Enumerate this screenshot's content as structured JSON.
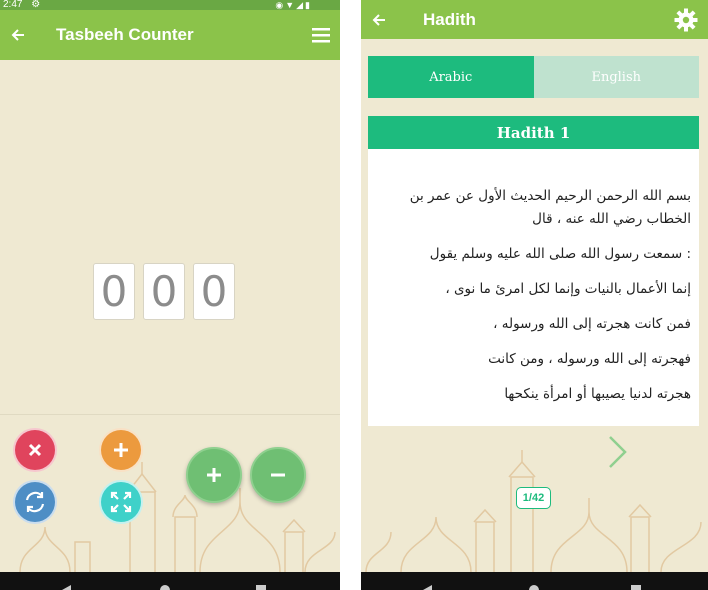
{
  "tasbeeh": {
    "status_time": "2:47",
    "title": "Tasbeeh Counter",
    "digits": [
      "0",
      "0",
      "0"
    ],
    "colors": {
      "reset": "#e0445d",
      "add": "#ec9a3e",
      "refresh": "#4e8ec5",
      "fullscreen": "#3fd1c9",
      "increment": "#6fbf73",
      "decrement": "#6fbf73"
    },
    "icons": [
      "back-arrow-icon",
      "menu-icon",
      "close-icon",
      "plus-icon",
      "refresh-icon",
      "expand-icon",
      "minus-icon"
    ]
  },
  "hadith": {
    "title": "Hadith",
    "tabs": [
      {
        "label": "Arabic",
        "active": true
      },
      {
        "label": "English",
        "active": false
      }
    ],
    "card_title": "Hadith 1",
    "lines": [
      "بسم الله الرحمن الرحيم الحديث الأول عن عمر بن الخطاب رضي الله عنه ، قال",
      ": سمعت رسول الله صلى الله عليه وسلم يقول",
      "إنما الأعمال بالنيات وإنما لكل امرئ ما نوى ،",
      "فمن كانت هجرته إلى الله ورسوله ،",
      "فهجرته إلى الله ورسوله ، ومن كانت",
      "هجرته لدنيا يصيبها أو امرأة ينكحها"
    ],
    "page_indicator": "1/42",
    "colors": {
      "accent": "#1dbb7e",
      "appbar": "#8bc34a",
      "background": "#efe9d2"
    }
  }
}
